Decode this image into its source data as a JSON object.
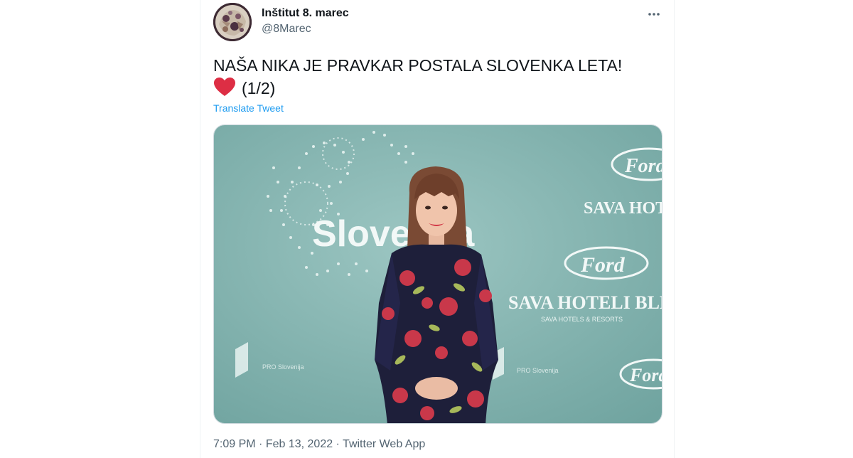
{
  "author": {
    "display_name": "Inštitut 8. marec",
    "handle": "@8Marec"
  },
  "tweet": {
    "text_line1": "NAŠA NIKA JE PRAVKAR POSTALA SLOVENKA LETA!",
    "text_line2": "(1/2)",
    "emoji": "heart-icon",
    "translate_label": "Translate Tweet"
  },
  "media": {
    "backdrop_texts": {
      "event_name": "Slovenka",
      "sponsor_ford": "Ford",
      "sponsor_sava_short": "SAVA HOT",
      "sponsor_sava_full": "SAVA HOTELI BLED",
      "sponsor_sava_sub": "SAVA HOTELS & RESORTS",
      "sponsor_pro": "PRO Slovenija"
    }
  },
  "meta": {
    "time": "7:09 PM",
    "separator": " · ",
    "date": "Feb 13, 2022",
    "source": "Twitter Web App"
  },
  "colors": {
    "text_primary": "#0f1419",
    "text_secondary": "#536471",
    "link": "#1d9bf0",
    "heart": "#e0245e",
    "backdrop": "#7aaeaa"
  }
}
